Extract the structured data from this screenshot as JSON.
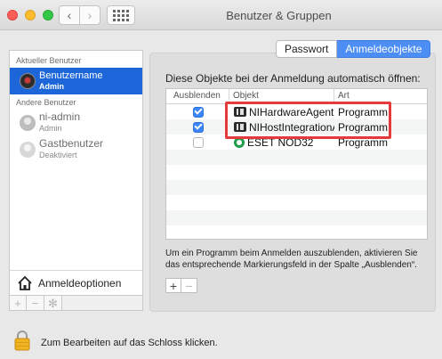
{
  "window": {
    "title": "Benutzer & Gruppen"
  },
  "nav": {
    "back": "‹",
    "forward": "›"
  },
  "tabs": [
    {
      "label": "Passwort",
      "active": false
    },
    {
      "label": "Anmeldeobjekte",
      "active": true
    }
  ],
  "sidebar": {
    "current_header": "Aktueller Benutzer",
    "current_user": {
      "name": "Benutzername",
      "role": "Admin"
    },
    "others_header": "Andere Benutzer",
    "other_users": [
      {
        "name": "ni-admin",
        "role": "Admin"
      },
      {
        "name": "Gastbenutzer",
        "role": "Deaktiviert"
      }
    ],
    "login_options": "Anmeldeoptionen",
    "add": "+",
    "remove": "−",
    "gear": "✻"
  },
  "main": {
    "heading": "Diese Objekte bei der Anmeldung automatisch öffnen:",
    "columns": [
      "Ausblenden",
      "Objekt",
      "Art"
    ],
    "rows": [
      {
        "hide": true,
        "name": "NIHardwareAgent",
        "kind": "Programm",
        "icon": "ni-app-icon"
      },
      {
        "hide": true,
        "name": "NIHostIntegrationA",
        "kind": "Programm",
        "icon": "ni-app-icon"
      },
      {
        "hide": false,
        "name": "ESET NOD32",
        "kind": "Programm",
        "icon": "eset-icon"
      }
    ],
    "hint": "Um ein Programm beim Anmelden auszublenden, aktivieren Sie das entsprechende Markierungsfeld in der Spalte „Ausblenden“.",
    "add": "+",
    "remove": "−"
  },
  "footer": {
    "lock_text": "Zum Bearbeiten auf das Schloss klicken."
  },
  "colors": {
    "selection": "#1c66d9",
    "accent": "#4d8ef4",
    "highlight": "#e43a3c"
  }
}
